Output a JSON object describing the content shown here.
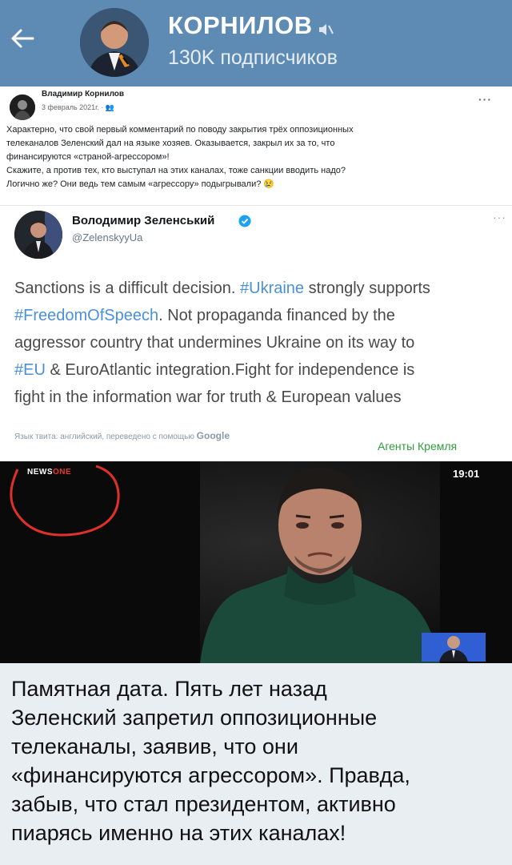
{
  "header": {
    "channel_name": "КОРНИЛОВ",
    "subscribers": "130K подписчиков"
  },
  "fb_post": {
    "author": "Владимир Корнилов",
    "date": "3 февраль 2021г. · ",
    "lines": [
      "Характерно, что свой первый комментарий по поводу закрытия трёх оппозиционных",
      "телеканалов Зеленский дал на языке хозяев. Оказывается, закрыл их за то, что",
      "финансируются «страной-агрессором»!",
      "Скажите, а против тех, кто выступал на этих каналах, тоже санкции вводить надо?",
      "Логично же? Они ведь тем самым «агрессору» подыгрывали? 😢"
    ]
  },
  "tweet": {
    "name": "Володимир Зеленський",
    "handle": "@ZelenskyyUa",
    "line1_a": "Sanctions is a difficult decision. ",
    "line1_tag": "#Ukraine",
    "line1_b": " strongly supports",
    "line2_tag": "#FreedomOfSpeech",
    "line2_b": ". Not propaganda financed by the",
    "line3": "aggressor country that undermines Ukraine on its way to",
    "line4_tag": "#EU",
    "line4_b": " & EuroAtlantic integration.Fight for independence is",
    "line5": "fight in the information war for truth & European values",
    "translate_note": "Язык твита: английский, переведено с помощью ",
    "translate_brand": "Google",
    "watermark": "Агенты Кремля"
  },
  "video": {
    "channel_prefix": "NEWS",
    "channel_suffix": "ONE",
    "time": "19:01"
  },
  "caption": {
    "lines": [
      "Памятная дата. Пять лет назад",
      "Зеленский запретил оппозиционные",
      "телеканалы, заявив, что они",
      "«финансируются агрессором». Правда,",
      "забыв, что стал президентом, активно",
      "пиарясь именно на этих каналах!"
    ]
  },
  "colors": {
    "header_bg": "#5d8bb4",
    "hashtag": "#4a90d9",
    "watermark": "#2e9e3a",
    "annotation_red": "#e0302a"
  }
}
